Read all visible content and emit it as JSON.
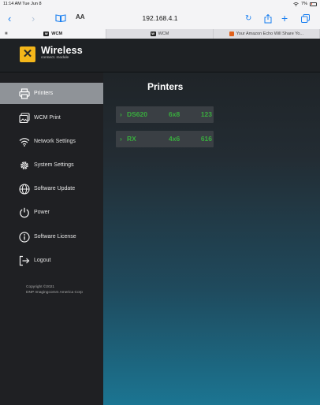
{
  "status_bar": {
    "time": "11:14 AM",
    "date": "Tue Jun 8",
    "battery": "7%"
  },
  "browser": {
    "text_size_label": "AA",
    "address": "192.168.4.1",
    "tabs": [
      {
        "label": "WCM",
        "active": true
      },
      {
        "label": "WCM",
        "active": false
      },
      {
        "label": "Your Amazon Echo Will Share Yo...",
        "active": false
      }
    ]
  },
  "app": {
    "logo_title": "Wireless",
    "logo_subtitle": "connect. module",
    "close_icon": "x-icon",
    "accent_color": "#f4b61a"
  },
  "sidebar": {
    "items": [
      {
        "label": "Printers",
        "icon": "printer-icon",
        "active": true
      },
      {
        "label": "WCM Print",
        "icon": "image-icon",
        "active": false
      },
      {
        "label": "Network Settings",
        "icon": "wifi-icon",
        "active": false
      },
      {
        "label": "System Settings",
        "icon": "gear-icon",
        "active": false
      },
      {
        "label": "Software Update",
        "icon": "globe-icon",
        "active": false
      },
      {
        "label": "Power",
        "icon": "power-icon",
        "active": false
      },
      {
        "label": "Software License",
        "icon": "info-icon",
        "active": false
      },
      {
        "label": "Logout",
        "icon": "logout-icon",
        "active": false
      }
    ],
    "copyright_line1": "Copyright ©2021",
    "copyright_line2": "DNP Imagingcomm America Corp"
  },
  "main": {
    "title": "Printers",
    "printers": [
      {
        "name": "DS620",
        "size": "6x8",
        "count": "123"
      },
      {
        "name": "RX",
        "size": "4x6",
        "count": "616"
      }
    ],
    "printer_text_color": "#39ad3e"
  }
}
